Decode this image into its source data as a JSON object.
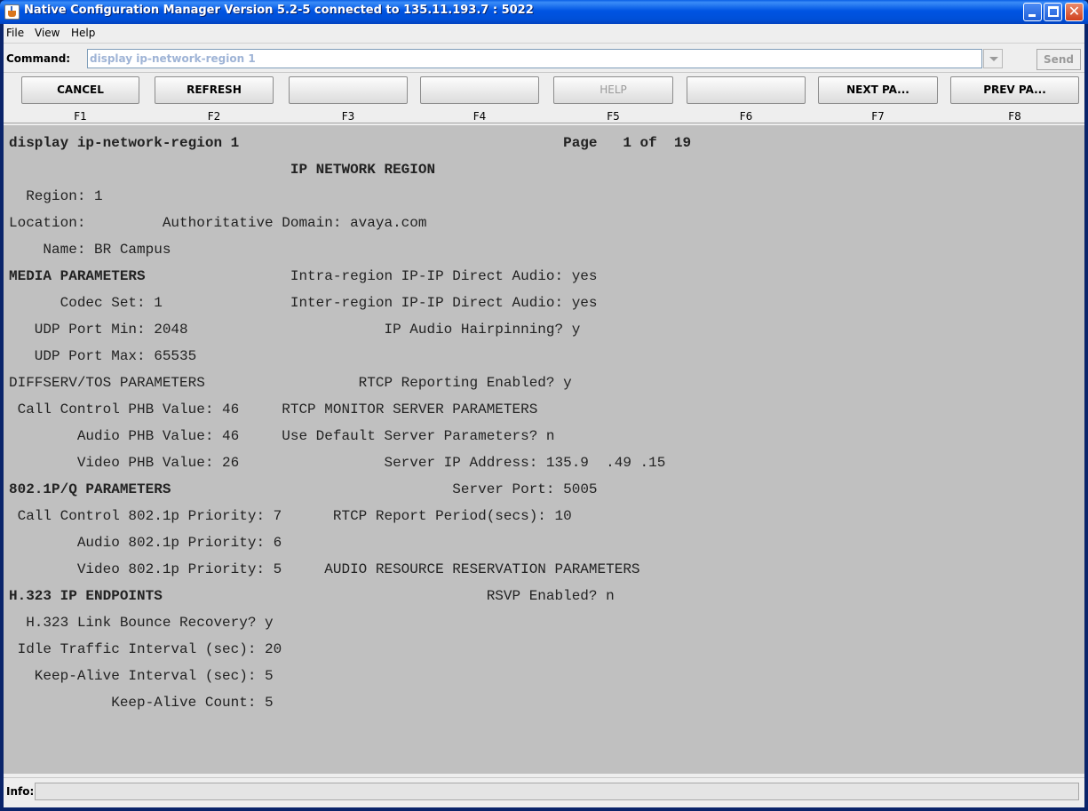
{
  "window": {
    "title": "Native Configuration Manager Version 5.2-5 connected to 135.11.193.7 : 5022",
    "icon": "java-cup-icon"
  },
  "menu": [
    "File",
    "View",
    "Help"
  ],
  "command": {
    "label": "Command:",
    "value": "display ip-network-region 1",
    "send_label": "Send"
  },
  "fkeys": [
    {
      "key": "F1",
      "label": "CANCEL",
      "enabled": true
    },
    {
      "key": "F2",
      "label": "REFRESH",
      "enabled": true
    },
    {
      "key": "F3",
      "label": "",
      "enabled": true
    },
    {
      "key": "F4",
      "label": "",
      "enabled": true
    },
    {
      "key": "F5",
      "label": "HELP",
      "enabled": false
    },
    {
      "key": "F6",
      "label": "",
      "enabled": true
    },
    {
      "key": "F7",
      "label": "NEXT  PA...",
      "enabled": true
    },
    {
      "key": "F8",
      "label": "PREV  PA...",
      "enabled": true
    }
  ],
  "screen": {
    "lines": [
      {
        "text": "display ip-network-region 1                                      Page   1 of  19",
        "bold": true
      },
      {
        "text": "                                 IP NETWORK REGION",
        "bold": true
      },
      {
        "text": "  Region: 1",
        "bold": false
      },
      {
        "text": "Location:         Authoritative Domain: avaya.com",
        "bold": false
      },
      {
        "text": "    Name: BR Campus",
        "bold": false
      },
      {
        "text": "MEDIA PARAMETERS                 Intra-region IP-IP Direct Audio: yes",
        "bold": false,
        "bold_prefix": "MEDIA PARAMETERS"
      },
      {
        "text": "      Codec Set: 1               Inter-region IP-IP Direct Audio: yes",
        "bold": false
      },
      {
        "text": "   UDP Port Min: 2048                       IP Audio Hairpinning? y",
        "bold": false
      },
      {
        "text": "   UDP Port Max: 65535",
        "bold": false
      },
      {
        "text": "DIFFSERV/TOS PARAMETERS                  RTCP Reporting Enabled? y",
        "bold": false
      },
      {
        "text": " Call Control PHB Value: 46     RTCP MONITOR SERVER PARAMETERS",
        "bold": false
      },
      {
        "text": "        Audio PHB Value: 46     Use Default Server Parameters? n",
        "bold": false
      },
      {
        "text": "        Video PHB Value: 26                 Server IP Address: 135.9  .49 .15",
        "bold": false
      },
      {
        "text": "802.1P/Q PARAMETERS                                 Server Port: 5005",
        "bold": false,
        "bold_prefix": "802.1P/Q PARAMETERS"
      },
      {
        "text": " Call Control 802.1p Priority: 7      RTCP Report Period(secs): 10",
        "bold": false
      },
      {
        "text": "        Audio 802.1p Priority: 6",
        "bold": false
      },
      {
        "text": "        Video 802.1p Priority: 5     AUDIO RESOURCE RESERVATION PARAMETERS",
        "bold": false
      },
      {
        "text": "H.323 IP ENDPOINTS                                      RSVP Enabled? n",
        "bold": false,
        "bold_prefix": "H.323 IP ENDPOINTS"
      },
      {
        "text": "  H.323 Link Bounce Recovery? y",
        "bold": false
      },
      {
        "text": " Idle Traffic Interval (sec): 20",
        "bold": false
      },
      {
        "text": "   Keep-Alive Interval (sec): 5",
        "bold": false
      },
      {
        "text": "            Keep-Alive Count: 5",
        "bold": false
      }
    ]
  },
  "info": {
    "label": "Info:",
    "value": ""
  }
}
